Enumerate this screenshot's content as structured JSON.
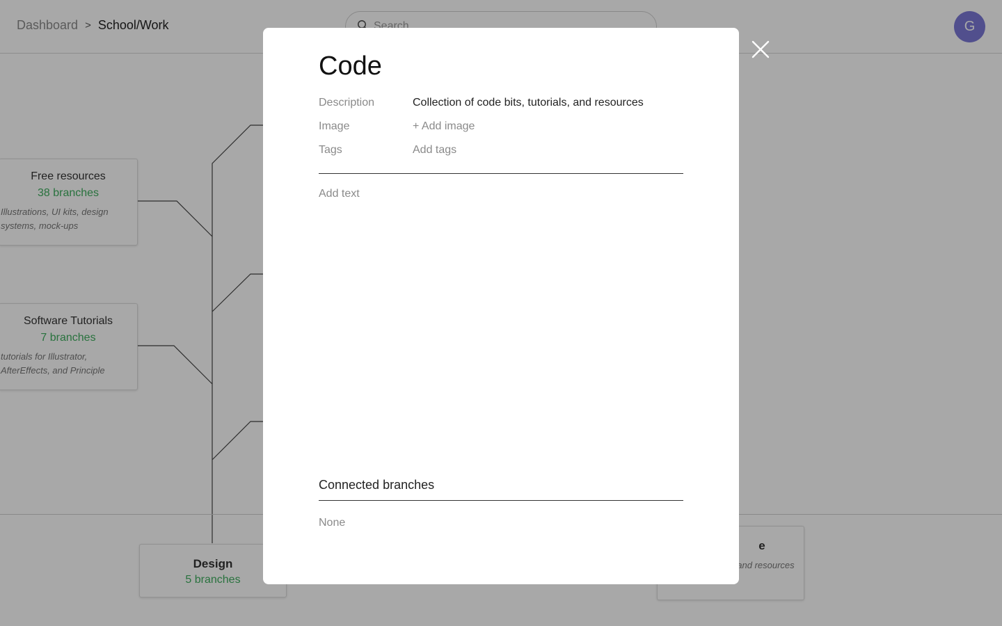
{
  "header": {
    "breadcrumb": {
      "root": "Dashboard",
      "separator": ">",
      "current": "School/Work"
    },
    "search": {
      "placeholder": "Search",
      "value": ""
    },
    "avatar": {
      "initial": "G",
      "color": "#7b79d6"
    }
  },
  "tree": {
    "nodes": [
      {
        "title": "Free resources",
        "count": "38 branches",
        "description": "Illustrations, UI kits, design systems, mock-ups"
      },
      {
        "title": "Software Tutorials",
        "count": "7 branches",
        "description": "tutorials for Illustrator, AfterEffects, and Principle"
      },
      {
        "title": "Design",
        "count": "5 branches"
      },
      {
        "title": "e",
        "description": "de bits, tutorials, and resources"
      }
    ]
  },
  "modal": {
    "title": "Code",
    "fields": {
      "description_label": "Description",
      "description_value": "Collection of code bits, tutorials, and resources",
      "image_label": "Image",
      "image_action": "+ Add image",
      "tags_label": "Tags",
      "tags_action": "Add tags"
    },
    "body_placeholder": "Add text",
    "connected": {
      "title": "Connected branches",
      "empty": "None"
    }
  },
  "colors": {
    "accent_green": "#3fae5f",
    "avatar": "#7b79d6",
    "overlay": "rgba(0,0,0,0.34)"
  }
}
